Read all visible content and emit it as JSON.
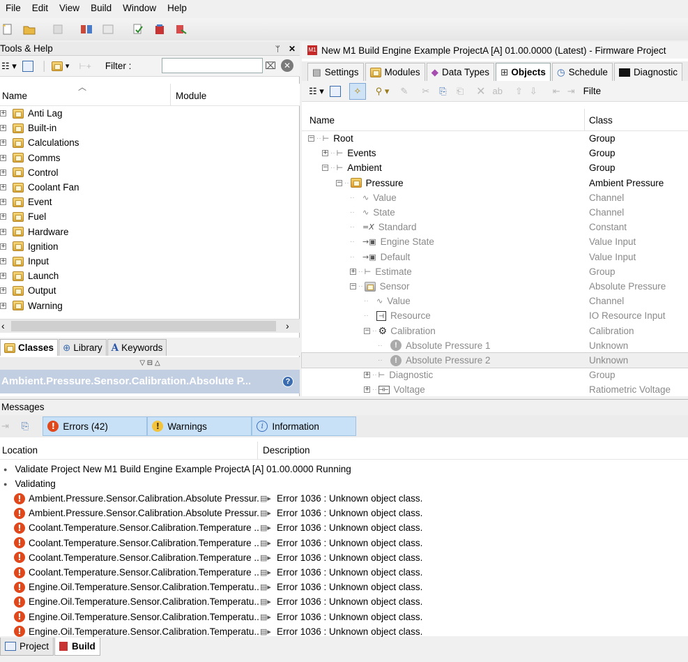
{
  "menu": [
    "File",
    "Edit",
    "View",
    "Build",
    "Window",
    "Help"
  ],
  "tools": {
    "title": "Tools & Help",
    "pin_glyph": "ᛘ",
    "close_glyph": "✕",
    "filter_label": "Filter :",
    "col_name": "Name",
    "col_module": "Module",
    "sort_glyph": "︿",
    "items": [
      "Anti Lag",
      "Built-in",
      "Calculations",
      "Comms",
      "Control",
      "Coolant Fan",
      "Event",
      "Fuel",
      "Hardware",
      "Ignition",
      "Input",
      "Launch",
      "Output",
      "Warning"
    ],
    "tabs": [
      "Classes",
      "Library",
      "Keywords"
    ],
    "split_glyphs": "▽ ⊟ △",
    "status": "Ambient.Pressure.Sensor.Calibration.Absolute P..."
  },
  "project": {
    "title": "New M1 Build Engine Example ProjectA [A] 01.00.0000 (Latest) - Firmware Project",
    "tabs": [
      "Settings",
      "Modules",
      "Data Types",
      "Objects",
      "Schedule",
      "Diagnostic"
    ],
    "toolbar_tail": "Filte",
    "col_name": "Name",
    "col_class": "Class",
    "rows": [
      {
        "name": "Root",
        "class": "Group"
      },
      {
        "name": "Events",
        "class": "Group"
      },
      {
        "name": "Ambient",
        "class": "Group"
      },
      {
        "name": "Pressure",
        "class": "Ambient Pressure"
      },
      {
        "name": "Value",
        "class": "Channel"
      },
      {
        "name": "State",
        "class": "Channel"
      },
      {
        "name": "Standard",
        "class": "Constant"
      },
      {
        "name": "Engine State",
        "class": "Value Input"
      },
      {
        "name": "Default",
        "class": "Value Input"
      },
      {
        "name": "Estimate",
        "class": "Group"
      },
      {
        "name": "Sensor",
        "class": "Absolute Pressure"
      },
      {
        "name": "Value",
        "class": "Channel"
      },
      {
        "name": "Resource",
        "class": "IO Resource Input"
      },
      {
        "name": "Calibration",
        "class": "Calibration"
      },
      {
        "name": "Absolute Pressure 1",
        "class": "Unknown"
      },
      {
        "name": "Absolute Pressure 2",
        "class": "Unknown"
      },
      {
        "name": "Diagnostic",
        "class": "Group"
      },
      {
        "name": "Voltage",
        "class": "Ratiometric Voltage"
      }
    ]
  },
  "messages": {
    "title": "Messages",
    "errors_label": "Errors (42)",
    "warnings_label": "Warnings",
    "info_label": "Information",
    "col_location": "Location",
    "col_description": "Description",
    "running": "Validate Project New M1 Build Engine Example ProjectA [A] 01.00.0000 Running",
    "validating": "Validating",
    "errors": [
      {
        "loc": "Ambient.Pressure.Sensor.Calibration.Absolute Pressur...",
        "desc": "Error 1036 : Unknown object class."
      },
      {
        "loc": "Ambient.Pressure.Sensor.Calibration.Absolute Pressur...",
        "desc": "Error 1036 : Unknown object class."
      },
      {
        "loc": "Coolant.Temperature.Sensor.Calibration.Temperature ...",
        "desc": "Error 1036 : Unknown object class."
      },
      {
        "loc": "Coolant.Temperature.Sensor.Calibration.Temperature ...",
        "desc": "Error 1036 : Unknown object class."
      },
      {
        "loc": "Coolant.Temperature.Sensor.Calibration.Temperature ...",
        "desc": "Error 1036 : Unknown object class."
      },
      {
        "loc": "Coolant.Temperature.Sensor.Calibration.Temperature ...",
        "desc": "Error 1036 : Unknown object class."
      },
      {
        "loc": "Engine.Oil.Temperature.Sensor.Calibration.Temperatu...",
        "desc": "Error 1036 : Unknown object class."
      },
      {
        "loc": "Engine.Oil.Temperature.Sensor.Calibration.Temperatu...",
        "desc": "Error 1036 : Unknown object class."
      },
      {
        "loc": "Engine.Oil.Temperature.Sensor.Calibration.Temperatu...",
        "desc": "Error 1036 : Unknown object class."
      },
      {
        "loc": "Engine.Oil.Temperature.Sensor.Calibration.Temperatu...",
        "desc": "Error 1036 : Unknown object class."
      }
    ]
  },
  "bottom_tabs": [
    "Project",
    "Build"
  ],
  "colors": {
    "accent": "#c8e1f6",
    "status_bg": "#c2cfe2",
    "error": "#e0481c",
    "warning": "#f3c33b"
  }
}
